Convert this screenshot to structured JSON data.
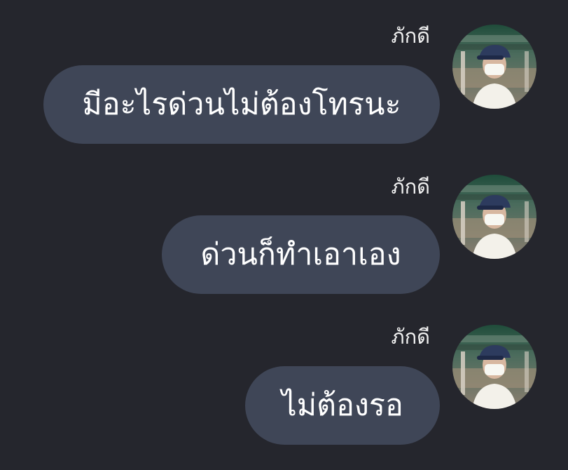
{
  "theme": {
    "background": "#25262d",
    "bubble": "#3f4657",
    "text": "#ffffff"
  },
  "messages": [
    {
      "sender": "ภักดี",
      "text": "มีอะไรด่วนไม่ต้องโทรนะ",
      "avatar_icon": "user-avatar"
    },
    {
      "sender": "ภักดี",
      "text": "ด่วนก็ทำเอาเอง",
      "avatar_icon": "user-avatar"
    },
    {
      "sender": "ภักดี",
      "text": "ไม่ต้องรอ",
      "avatar_icon": "user-avatar"
    }
  ]
}
